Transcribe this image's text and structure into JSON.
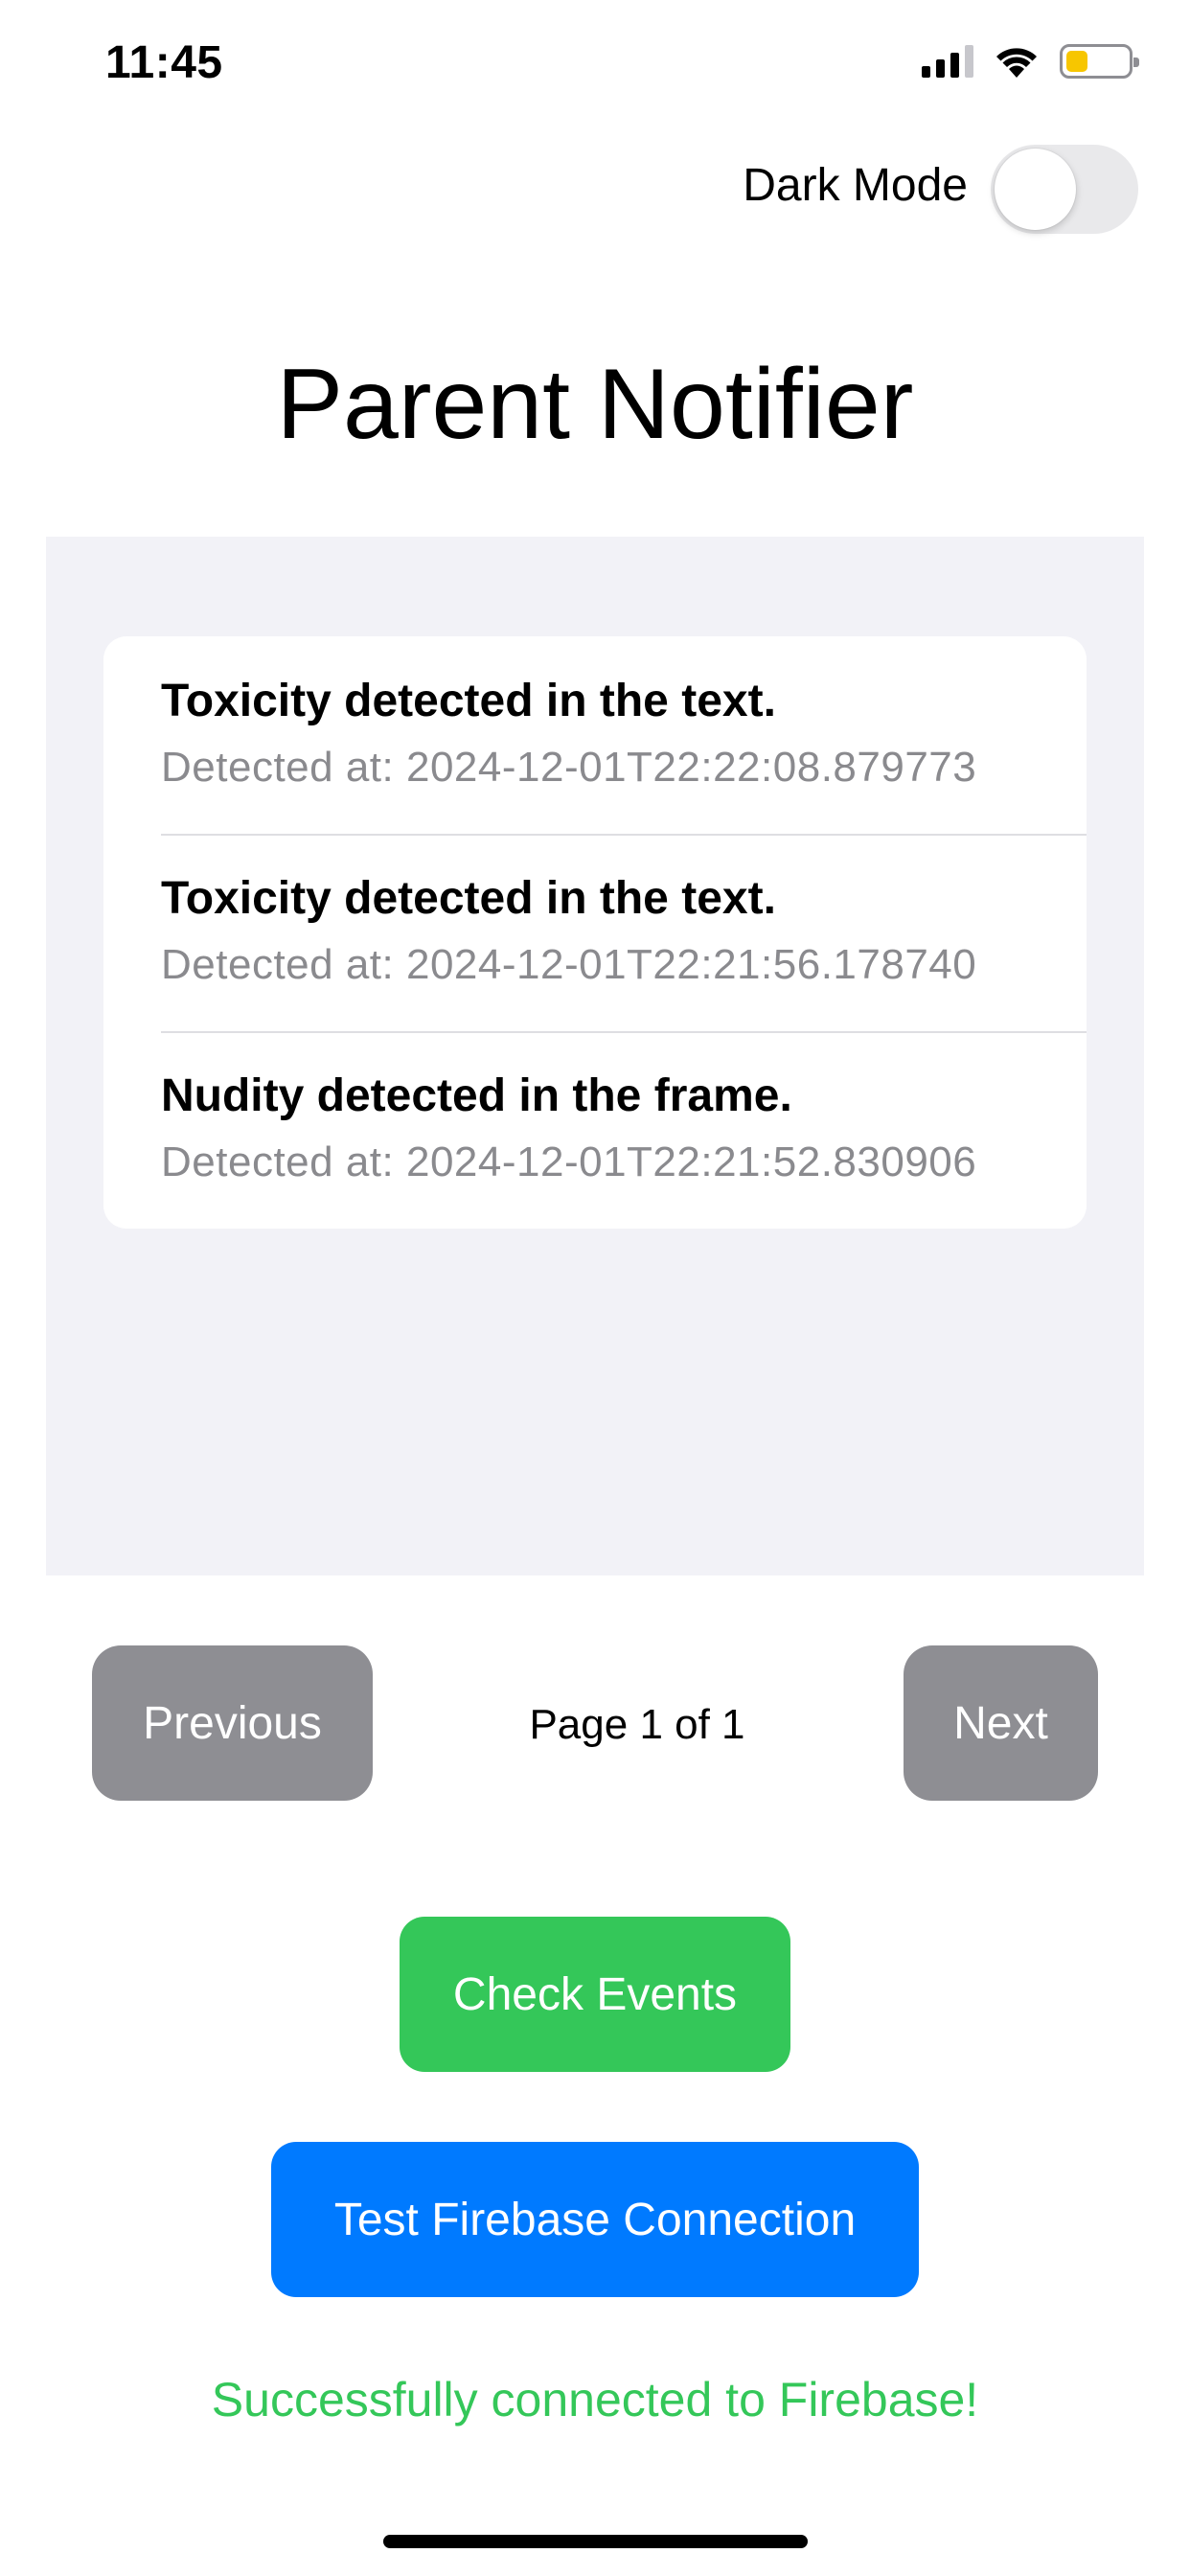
{
  "status_bar": {
    "time": "11:45",
    "icons": [
      "signal-icon",
      "wifi-icon",
      "battery-icon"
    ],
    "battery_level": 0.35,
    "battery_color": "#f7c600"
  },
  "settings": {
    "dark_mode_label": "Dark Mode",
    "dark_mode_on": false
  },
  "title": "Parent Notifier",
  "notifications": [
    {
      "message": "Toxicity detected in the text.",
      "detected_at": "Detected at: 2024-12-01T22:22:08.879773"
    },
    {
      "message": "Toxicity detected in the text.",
      "detected_at": "Detected at: 2024-12-01T22:21:56.178740"
    },
    {
      "message": "Nudity detected in the frame.",
      "detected_at": "Detected at: 2024-12-01T22:21:52.830906"
    }
  ],
  "pagination": {
    "previous_label": "Previous",
    "page_indicator": "Page 1 of 1",
    "next_label": "Next"
  },
  "actions": {
    "check_events_label": "Check Events",
    "test_firebase_label": "Test Firebase Connection"
  },
  "status_message": "Successfully connected to Firebase!",
  "colors": {
    "success_green": "#34c759",
    "primary_blue": "#007aff",
    "disabled_grey": "#8e8e93",
    "panel_background": "#f2f2f7"
  }
}
